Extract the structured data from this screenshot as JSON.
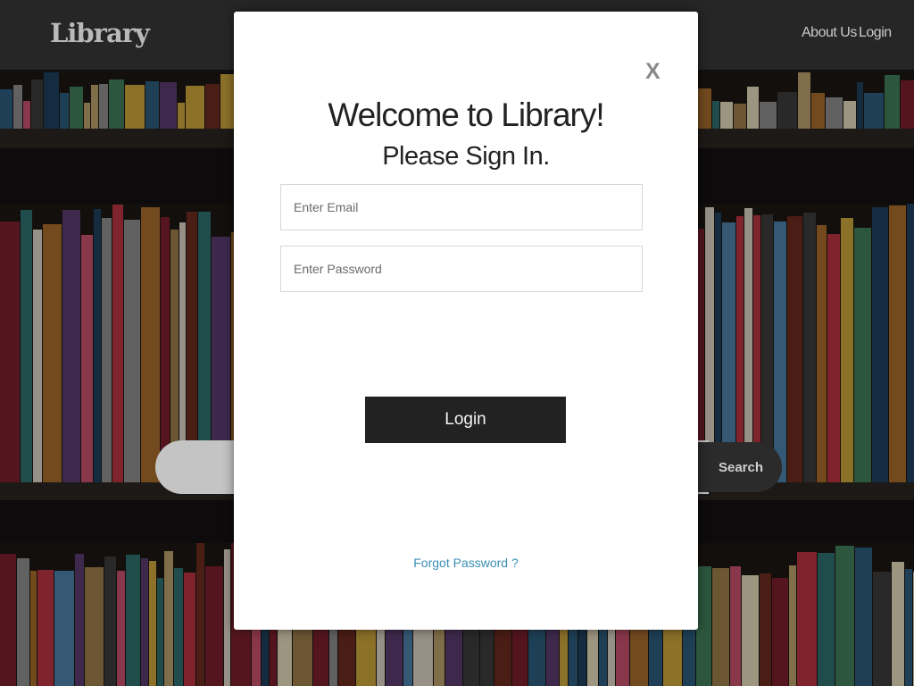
{
  "navbar": {
    "brand": "Library",
    "links": [
      "About Us",
      "Login"
    ]
  },
  "search": {
    "placeholder": "",
    "button_label": "Search"
  },
  "modal": {
    "close_label": "X",
    "title": "Welcome to Library!",
    "subtitle": "Please Sign In.",
    "email_placeholder": "Enter Email",
    "password_placeholder": "Enter Password",
    "login_label": "Login",
    "forgot_label": "Forgot Password ?"
  },
  "colors": {
    "navbar_bg": "#262626",
    "modal_bg": "#ffffff",
    "button_bg": "#222222",
    "link": "#3a8fb5"
  }
}
